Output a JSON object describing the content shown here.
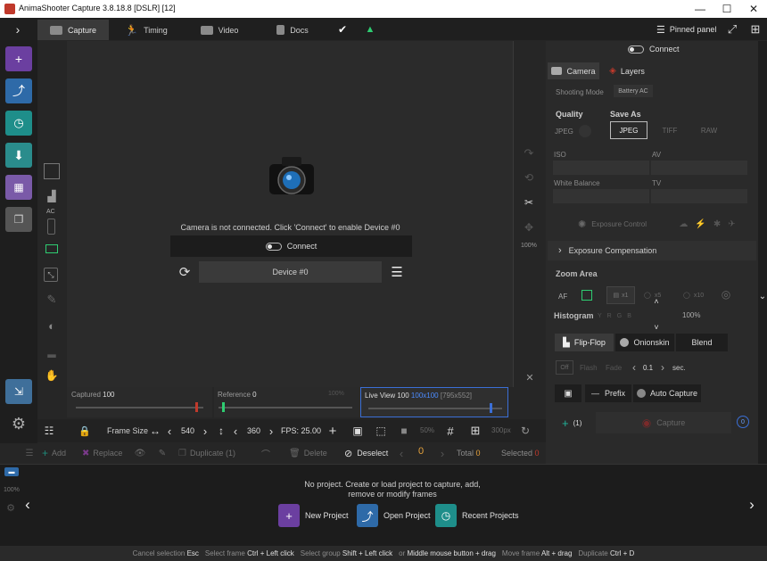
{
  "window": {
    "title": "AnimaShooter Capture 3.8.18.8 [DSLR] [12]"
  },
  "tabs": [
    {
      "label": "Capture",
      "icon": "camera-icon",
      "active": true
    },
    {
      "label": "Timing",
      "icon": "runner-icon",
      "active": false
    },
    {
      "label": "Video",
      "icon": "film-icon",
      "active": false
    },
    {
      "label": "Docs",
      "icon": "document-icon",
      "active": false
    }
  ],
  "topbar": {
    "pinned_panel": "Pinned panel"
  },
  "left_tools": {
    "ac_label": "AC"
  },
  "viewport": {
    "message": "Camera is not connected. Click 'Connect' to enable Device #0",
    "connect_label": "Connect",
    "device_label": "Device #0",
    "zoom_pct": "100%"
  },
  "frame_bar": {
    "captured_label": "Captured",
    "captured_value": "100",
    "reference_label": "Reference",
    "reference_value": "0",
    "reference_pct": "100%",
    "liveview_label": "Live View",
    "liveview_value": "100",
    "liveview_size": "100x100",
    "liveview_dims": "[795x552]"
  },
  "frame_tool": {
    "frame_size_label": "Frame Size",
    "width": "540",
    "height": "360",
    "fps": "FPS: 25.00",
    "pct": "50%",
    "px": "300px"
  },
  "action_bar": {
    "add": "Add",
    "replace": "Replace",
    "duplicate": "Duplicate (1)",
    "delete": "Delete",
    "deselect": "Deselect",
    "count": "0",
    "total_label": "Total",
    "total_value": "0",
    "selected_label": "Selected",
    "selected_value": "0"
  },
  "timeline": {
    "message_line1": "No project. Create or load project to capture, add,",
    "message_line2": "remove or modify frames",
    "new_project": "New Project",
    "open_project": "Open Project",
    "recent_projects": "Recent Projects",
    "zoom": "100%"
  },
  "status_bar": [
    {
      "label": "Cancel selection",
      "key": "Esc"
    },
    {
      "label": "Select frame",
      "key": "Ctrl + Left click"
    },
    {
      "label": "Select group",
      "key": "Shift + Left click"
    },
    {
      "label": "or",
      "key": "Middle mouse button + drag"
    },
    {
      "label": "Move frame",
      "key": "Alt + drag"
    },
    {
      "label": "Duplicate",
      "key": "Ctrl + D"
    }
  ],
  "right_panel": {
    "connect_label": "Connect",
    "tabs": [
      {
        "label": "Camera",
        "active": true
      },
      {
        "label": "Layers",
        "active": false
      }
    ],
    "shooting_mode_label": "Shooting Mode",
    "shooting_mode_value": "Battery AC",
    "quality_label": "Quality",
    "quality_value": "JPEG",
    "save_as_label": "Save As",
    "save_as_options": [
      "JPEG",
      "TIFF",
      "RAW"
    ],
    "iso_label": "ISO",
    "av_label": "AV",
    "white_balance_label": "White Balance",
    "tv_label": "TV",
    "exposure_control": "Exposure Control",
    "exposure_compensation": "Exposure Compensation",
    "zoom_area": "Zoom Area",
    "af_label": "AF",
    "x1": "x1",
    "x5": "x5",
    "x10": "x10",
    "histogram_label": "Histogram",
    "histogram_channels": [
      "Y",
      "R",
      "G",
      "B"
    ],
    "histogram_pct": "100%",
    "flip_flop": "Flip-Flop",
    "onionskin": "Onionskin",
    "blend": "Blend",
    "off": "Off",
    "flash": "Flash",
    "fade": "Fade",
    "fade_value": "0.1",
    "sec": "sec.",
    "prefix": "Prefix",
    "auto_capture": "Auto Capture",
    "plus_count": "(1)",
    "capture": "Capture",
    "capture_count": "0"
  },
  "colors": {
    "accent_blue": "#3b6fd6",
    "liveview_value": "#4c8cff",
    "capture_red": "#c0392b",
    "add_green": "#21b39a",
    "total_orange": "#e6a23c"
  }
}
